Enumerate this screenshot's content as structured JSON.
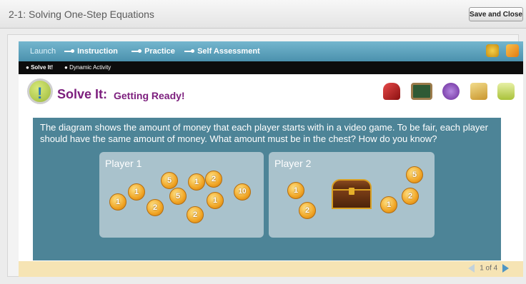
{
  "window": {
    "title": "2-1: Solving One-Step Equations",
    "save_close_label": "Save and Close"
  },
  "nav": {
    "items": [
      "Launch",
      "Instruction",
      "Practice",
      "Self Assessment"
    ],
    "icons": [
      "refresh-icon",
      "pencil-icon"
    ]
  },
  "subnav": {
    "items": [
      "Solve It!",
      "Dynamic Activity"
    ]
  },
  "header": {
    "badge_icon": "solve-it-badge-icon",
    "solve_label": "Solve It:",
    "subtitle": "Getting Ready!",
    "tools": [
      "highlighter-icon",
      "whiteboard-icon",
      "audio-icon",
      "notes-icon",
      "eraser-icon"
    ]
  },
  "activity": {
    "prompt": "The diagram shows the amount of money that each player starts with in a video game.  To be fair, each player should have the same amount of money.  What amount must be in the chest?  How do you know?",
    "player1": {
      "label": "Player 1",
      "coins": [
        "1",
        "1",
        "5",
        "2",
        "5",
        "1",
        "2",
        "1",
        "2",
        "10"
      ]
    },
    "player2": {
      "label": "Player 2",
      "coins": [
        "1",
        "2",
        "5",
        "2",
        "1"
      ]
    }
  },
  "pager": {
    "text": "1 of 4"
  },
  "colors": {
    "nav_blue": "#5aa2be",
    "panel_teal": "#4d8497",
    "player_box": "#a9c2cc",
    "title_purple": "#7c1e7d",
    "footer": "#f6e4b4"
  }
}
